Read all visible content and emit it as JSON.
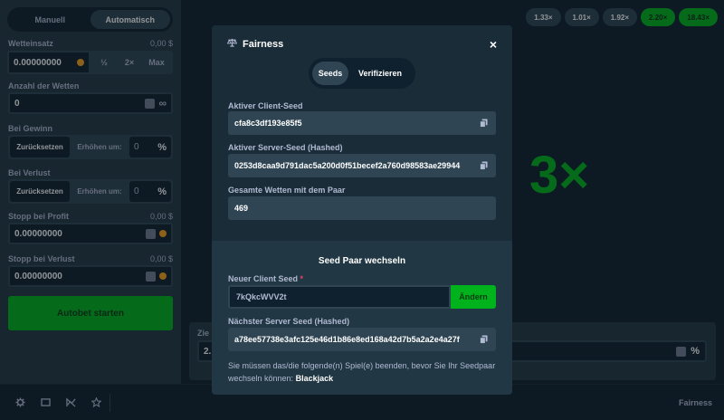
{
  "sidebar": {
    "tabs": [
      {
        "label": "Manuell"
      },
      {
        "label": "Automatisch"
      }
    ],
    "bet_amount": {
      "label": "Wetteinsatz",
      "value_display": "0,00 $",
      "input_value": "0.00000000",
      "half": "½",
      "double": "2×",
      "max": "Max"
    },
    "num_bets": {
      "label": "Anzahl der Wetten",
      "input_value": "0",
      "infinity": "∞"
    },
    "on_win": {
      "label": "Bei Gewinn",
      "reset": "Zurücksetzen",
      "increase": "Erhöhen um:",
      "value": "0",
      "percent": "%"
    },
    "on_loss": {
      "label": "Bei Verlust",
      "reset": "Zurücksetzen",
      "increase": "Erhöhen um:",
      "value": "0",
      "percent": "%"
    },
    "stop_profit": {
      "label": "Stopp bei Profit",
      "value_display": "0,00 $",
      "input_value": "0.00000000"
    },
    "stop_loss": {
      "label": "Stopp bei Verlust",
      "value_display": "0,00 $",
      "input_value": "0.00000000"
    },
    "start_button": "Autobet starten"
  },
  "main": {
    "multipliers": [
      "1.33×",
      "1.01×",
      "1.92×",
      "2.20×",
      "18.43×"
    ],
    "big_multiplier": "3×",
    "bottom_left_label": "Zie",
    "bottom_left_value": "2.",
    "bottom_right_percent": "%"
  },
  "bottombar": {
    "fairness": "Fairness"
  },
  "modal": {
    "title": "Fairness",
    "close": "×",
    "tabs": [
      {
        "label": "Seeds"
      },
      {
        "label": "Verifizieren"
      }
    ],
    "active_client_seed_label": "Aktiver Client-Seed",
    "active_client_seed": "cfa8c3df193e85f5",
    "active_server_seed_label": "Aktiver Server-Seed (Hashed)",
    "active_server_seed": "0253d8caa9d791dac5a200d0f51becef2a760d98583ae29944",
    "total_bets_label": "Gesamte Wetten mit dem Paar",
    "total_bets": "469",
    "change_title": "Seed Paar wechseln",
    "new_client_seed_label": "Neuer Client Seed",
    "required_mark": "*",
    "new_client_seed": "7kQkcWVV2t",
    "change_button": "Ändern",
    "next_server_seed_label": "Nächster Server Seed (Hashed)",
    "next_server_seed": "a78ee57738e3afc125e46d1b86e8ed168a42d7b5a2a2e4a27f",
    "note": "Sie müssen das/die folgende(n) Spiel(e) beenden, bevor Sie Ihr Seedpaar wechseln können:",
    "note_game": "Blackjack"
  },
  "colors": {
    "background": "#0f212e",
    "panel": "#213743",
    "accent_green": "#00b21c",
    "modal": "#1a2c38"
  }
}
